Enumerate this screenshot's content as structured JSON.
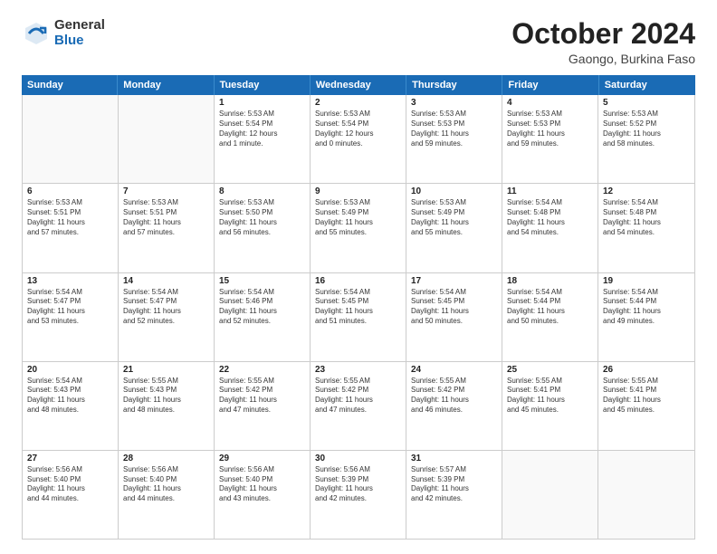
{
  "logo": {
    "general": "General",
    "blue": "Blue"
  },
  "title": "October 2024",
  "location": "Gaongo, Burkina Faso",
  "header": {
    "days": [
      "Sunday",
      "Monday",
      "Tuesday",
      "Wednesday",
      "Thursday",
      "Friday",
      "Saturday"
    ]
  },
  "weeks": [
    [
      {
        "day": "",
        "detail": ""
      },
      {
        "day": "",
        "detail": ""
      },
      {
        "day": "1",
        "detail": "Sunrise: 5:53 AM\nSunset: 5:54 PM\nDaylight: 12 hours\nand 1 minute."
      },
      {
        "day": "2",
        "detail": "Sunrise: 5:53 AM\nSunset: 5:54 PM\nDaylight: 12 hours\nand 0 minutes."
      },
      {
        "day": "3",
        "detail": "Sunrise: 5:53 AM\nSunset: 5:53 PM\nDaylight: 11 hours\nand 59 minutes."
      },
      {
        "day": "4",
        "detail": "Sunrise: 5:53 AM\nSunset: 5:53 PM\nDaylight: 11 hours\nand 59 minutes."
      },
      {
        "day": "5",
        "detail": "Sunrise: 5:53 AM\nSunset: 5:52 PM\nDaylight: 11 hours\nand 58 minutes."
      }
    ],
    [
      {
        "day": "6",
        "detail": "Sunrise: 5:53 AM\nSunset: 5:51 PM\nDaylight: 11 hours\nand 57 minutes."
      },
      {
        "day": "7",
        "detail": "Sunrise: 5:53 AM\nSunset: 5:51 PM\nDaylight: 11 hours\nand 57 minutes."
      },
      {
        "day": "8",
        "detail": "Sunrise: 5:53 AM\nSunset: 5:50 PM\nDaylight: 11 hours\nand 56 minutes."
      },
      {
        "day": "9",
        "detail": "Sunrise: 5:53 AM\nSunset: 5:49 PM\nDaylight: 11 hours\nand 55 minutes."
      },
      {
        "day": "10",
        "detail": "Sunrise: 5:53 AM\nSunset: 5:49 PM\nDaylight: 11 hours\nand 55 minutes."
      },
      {
        "day": "11",
        "detail": "Sunrise: 5:54 AM\nSunset: 5:48 PM\nDaylight: 11 hours\nand 54 minutes."
      },
      {
        "day": "12",
        "detail": "Sunrise: 5:54 AM\nSunset: 5:48 PM\nDaylight: 11 hours\nand 54 minutes."
      }
    ],
    [
      {
        "day": "13",
        "detail": "Sunrise: 5:54 AM\nSunset: 5:47 PM\nDaylight: 11 hours\nand 53 minutes."
      },
      {
        "day": "14",
        "detail": "Sunrise: 5:54 AM\nSunset: 5:47 PM\nDaylight: 11 hours\nand 52 minutes."
      },
      {
        "day": "15",
        "detail": "Sunrise: 5:54 AM\nSunset: 5:46 PM\nDaylight: 11 hours\nand 52 minutes."
      },
      {
        "day": "16",
        "detail": "Sunrise: 5:54 AM\nSunset: 5:45 PM\nDaylight: 11 hours\nand 51 minutes."
      },
      {
        "day": "17",
        "detail": "Sunrise: 5:54 AM\nSunset: 5:45 PM\nDaylight: 11 hours\nand 50 minutes."
      },
      {
        "day": "18",
        "detail": "Sunrise: 5:54 AM\nSunset: 5:44 PM\nDaylight: 11 hours\nand 50 minutes."
      },
      {
        "day": "19",
        "detail": "Sunrise: 5:54 AM\nSunset: 5:44 PM\nDaylight: 11 hours\nand 49 minutes."
      }
    ],
    [
      {
        "day": "20",
        "detail": "Sunrise: 5:54 AM\nSunset: 5:43 PM\nDaylight: 11 hours\nand 48 minutes."
      },
      {
        "day": "21",
        "detail": "Sunrise: 5:55 AM\nSunset: 5:43 PM\nDaylight: 11 hours\nand 48 minutes."
      },
      {
        "day": "22",
        "detail": "Sunrise: 5:55 AM\nSunset: 5:42 PM\nDaylight: 11 hours\nand 47 minutes."
      },
      {
        "day": "23",
        "detail": "Sunrise: 5:55 AM\nSunset: 5:42 PM\nDaylight: 11 hours\nand 47 minutes."
      },
      {
        "day": "24",
        "detail": "Sunrise: 5:55 AM\nSunset: 5:42 PM\nDaylight: 11 hours\nand 46 minutes."
      },
      {
        "day": "25",
        "detail": "Sunrise: 5:55 AM\nSunset: 5:41 PM\nDaylight: 11 hours\nand 45 minutes."
      },
      {
        "day": "26",
        "detail": "Sunrise: 5:55 AM\nSunset: 5:41 PM\nDaylight: 11 hours\nand 45 minutes."
      }
    ],
    [
      {
        "day": "27",
        "detail": "Sunrise: 5:56 AM\nSunset: 5:40 PM\nDaylight: 11 hours\nand 44 minutes."
      },
      {
        "day": "28",
        "detail": "Sunrise: 5:56 AM\nSunset: 5:40 PM\nDaylight: 11 hours\nand 44 minutes."
      },
      {
        "day": "29",
        "detail": "Sunrise: 5:56 AM\nSunset: 5:40 PM\nDaylight: 11 hours\nand 43 minutes."
      },
      {
        "day": "30",
        "detail": "Sunrise: 5:56 AM\nSunset: 5:39 PM\nDaylight: 11 hours\nand 42 minutes."
      },
      {
        "day": "31",
        "detail": "Sunrise: 5:57 AM\nSunset: 5:39 PM\nDaylight: 11 hours\nand 42 minutes."
      },
      {
        "day": "",
        "detail": ""
      },
      {
        "day": "",
        "detail": ""
      }
    ]
  ]
}
